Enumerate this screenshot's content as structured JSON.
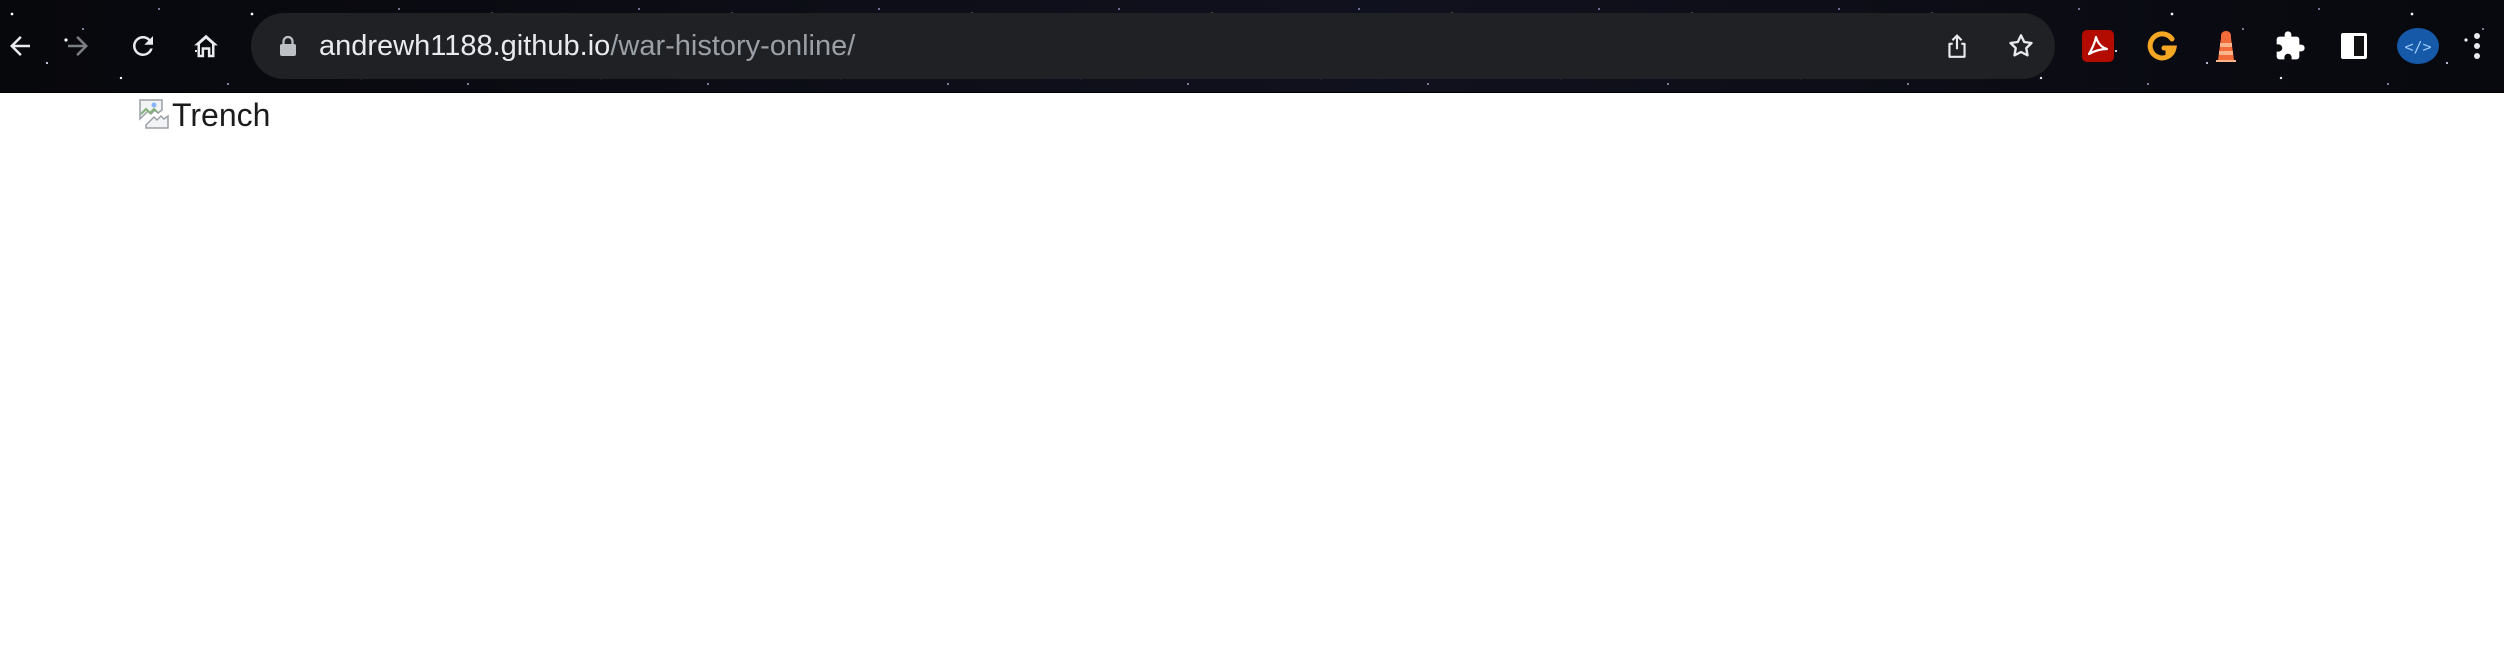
{
  "browser": {
    "url": {
      "host": "andrewh1188.github.io",
      "path": "/war-history-online/"
    },
    "nav": {
      "back_icon": "arrow-left-icon",
      "forward_icon": "arrow-right-icon",
      "reload_icon": "reload-icon",
      "home_icon": "home-icon"
    },
    "omnibox_actions": [
      "share-icon",
      "bookmark-star-icon"
    ],
    "extensions": [
      {
        "name": "adobe-acrobat-icon",
        "color": "#d0021b"
      },
      {
        "name": "grammarly-g-icon",
        "color": "#f5a623"
      },
      {
        "name": "lighthouse-icon",
        "color": "#f26b3a"
      },
      {
        "name": "extensions-puzzle-icon",
        "color": "#ffffff"
      },
      {
        "name": "reader-mode-icon",
        "color": "#ffffff"
      },
      {
        "name": "code-viewer-icon",
        "color": "#1a73e8"
      }
    ],
    "menu_icon": "kebab-menu-icon"
  },
  "page": {
    "image_alt": "Trench",
    "broken_image_icon": "broken-image-icon"
  }
}
